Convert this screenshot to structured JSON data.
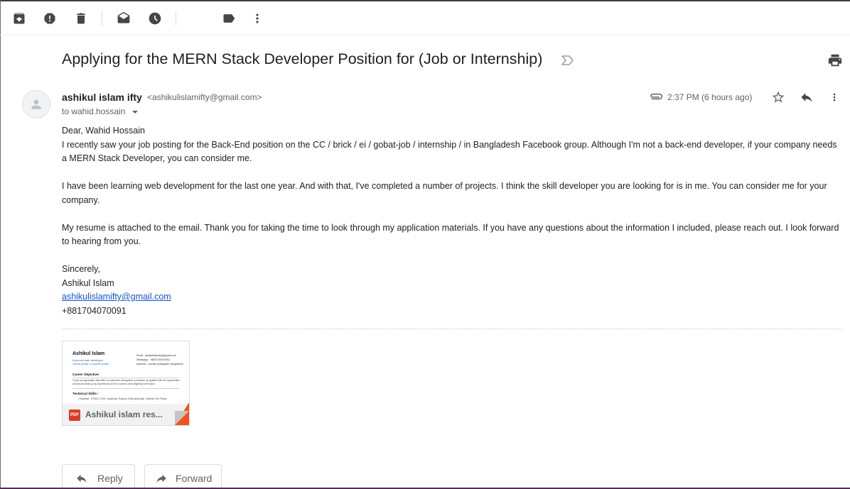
{
  "toolbar": {
    "icons": [
      "archive-icon",
      "report-spam-icon",
      "delete-icon",
      "mark-unread-icon",
      "snooze-icon",
      "label-icon",
      "more-vert-icon"
    ]
  },
  "email": {
    "subject": "Applying for the MERN Stack Developer Position for (Job or Internship)",
    "sender_name": "ashikul islam ifty",
    "sender_email": "<ashikulislamifty@gmail.com>",
    "to_label": "to wahid.hossain",
    "timestamp": "2:37 PM (6 hours ago)",
    "body": {
      "greeting": "Dear, Wahid Hossain",
      "p1": "I recently saw your job posting for the Back-End position on the CC / brick / ei / gobat-job / internship / in Bangladesh Facebook group. Although I'm not a back-end developer, if your company needs a MERN Stack Developer, you can consider me.",
      "p2": "I have been learning web development for the last one year. And with that, I've completed a number of projects. I think the skill developer you are looking for is in me. You can consider me for your company.",
      "p3": "My resume is attached to the email. Thank you for taking the time to look through my application materials. If you have any questions about the information I included, please reach out. I look forward to hearing from you.",
      "closing": "Sincerely,",
      "sig_name": "Ashikul Islam",
      "sig_email": "ashikulislamifty@gmail.com",
      "sig_phone": "+881704070091"
    }
  },
  "attachment": {
    "name": "Ashikul islam res...",
    "type_badge": "PDF",
    "preview": {
      "name": "Ashikul Islam",
      "role": "front-end web developer",
      "links": "Github profile | Linkedin profile",
      "contact": [
        "Email : ashikulislamifty@gmail.com",
        "Whatsapp : +8801704070091",
        "Address : comilla chattogram bangladesh"
      ],
      "section1": "Career Objective:",
      "objective": "To join an organization that offers a constructive atmosphere to enhance my qualities with the opportunities at hand and build up my experiences for the in order to work diligently in the future.",
      "section2": "Technical Skills :",
      "skills": "• Expertise : HTML5, CSS3, JavaScript, React.js, ES6(JavaScript), Tailwind CSS, Redux"
    }
  },
  "actions": {
    "reply_label": "Reply",
    "forward_label": "Forward"
  },
  "colors": {
    "link": "#1155cc",
    "pdf_red": "#db3a2a",
    "text_secondary": "#5f6368"
  }
}
